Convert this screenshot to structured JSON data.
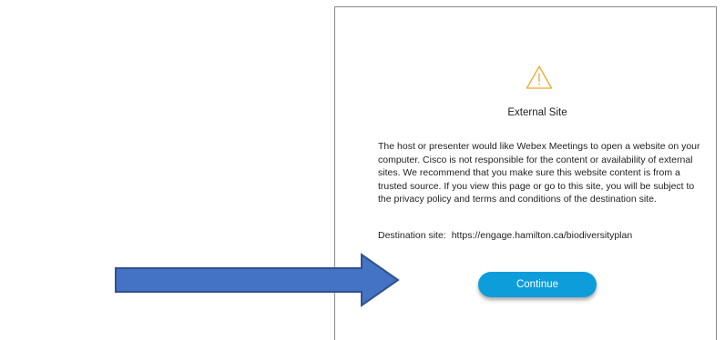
{
  "dialog": {
    "title": "External Site",
    "body": "The host or presenter would like Webex Meetings to open a website on your computer. Cisco is not responsible for the content or availability of external sites. We recommend that you make sure this website content is from a trusted source. If you view this page or go to this site, you will be subject to the privacy policy and terms and conditions of the destination site.",
    "destination_label": "Destination site:",
    "destination_url": "https://engage.hamilton.ca/biodiversityplan",
    "continue_label": "Continue",
    "icon": "warning-icon"
  },
  "annotation": {
    "icon": "arrow-right-icon"
  },
  "colors": {
    "button": "#0d9ddb",
    "warning_stroke": "#f0a830",
    "arrow_fill": "#4472c4",
    "arrow_stroke": "#2f528f"
  }
}
